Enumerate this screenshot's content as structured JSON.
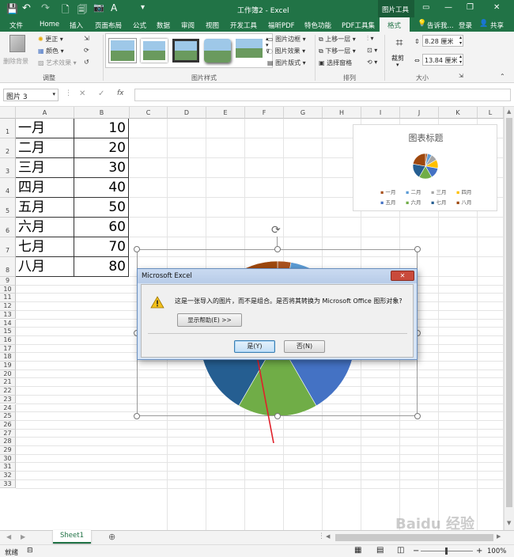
{
  "window": {
    "title": "工作簿2 - Excel",
    "context_tab_group": "图片工具",
    "controls": {
      "minimize": "—",
      "restore": "❐",
      "close": "✕"
    }
  },
  "ribbon_tabs": [
    {
      "label": "文件"
    },
    {
      "label": "Home"
    },
    {
      "label": "插入"
    },
    {
      "label": "页面布局"
    },
    {
      "label": "公式"
    },
    {
      "label": "数据"
    },
    {
      "label": "审阅"
    },
    {
      "label": "视图"
    },
    {
      "label": "开发工具"
    },
    {
      "label": "福昕PDF"
    },
    {
      "label": "特色功能"
    },
    {
      "label": "PDF工具集"
    },
    {
      "label": "格式"
    }
  ],
  "ribbon_right": {
    "tell_me": "告诉我...",
    "login": "登录",
    "share": "共享"
  },
  "ribbon": {
    "adjust": {
      "remove_bg": "删除背景",
      "corrections": "更正",
      "color": "颜色",
      "artistic": "艺术效果",
      "label": "调整"
    },
    "styles": {
      "border": "图片边框",
      "effects": "图片效果",
      "layout": "图片版式",
      "label": "图片样式"
    },
    "arrange": {
      "bring_forward": "上移一层",
      "send_backward": "下移一层",
      "selection_pane": "选择窗格",
      "label": "排列"
    },
    "size": {
      "crop": "裁剪",
      "height": "8.28 厘米",
      "width": "13.84 厘米",
      "label": "大小"
    }
  },
  "formula_bar": {
    "name_box": "图片 3",
    "fx": "fx",
    "cancel": "✕",
    "enter": "✓",
    "content": ""
  },
  "columns": [
    "A",
    "B",
    "C",
    "D",
    "E",
    "F",
    "G",
    "H",
    "I",
    "J",
    "K",
    "L"
  ],
  "rows": [
    "1",
    "2",
    "3",
    "4",
    "5",
    "6",
    "7",
    "8",
    "9",
    "10",
    "11",
    "12",
    "13",
    "14",
    "15",
    "16",
    "17",
    "18",
    "19",
    "20",
    "21",
    "22",
    "23",
    "24",
    "25",
    "26",
    "27",
    "28",
    "29",
    "30",
    "31",
    "32",
    "33"
  ],
  "cells": [
    {
      "a": "一月",
      "b": "10"
    },
    {
      "a": "二月",
      "b": "20"
    },
    {
      "a": "三月",
      "b": "30"
    },
    {
      "a": "四月",
      "b": "40"
    },
    {
      "a": "五月",
      "b": "50"
    },
    {
      "a": "六月",
      "b": "60"
    },
    {
      "a": "七月",
      "b": "70"
    },
    {
      "a": "八月",
      "b": "80"
    }
  ],
  "chart": {
    "title": "图表标题",
    "legend": [
      "一月",
      "二月",
      "三月",
      "四月",
      "五月",
      "六月",
      "七月",
      "八月"
    ],
    "colors": [
      "#a9521f",
      "#5b9bd5",
      "#a5a5a5",
      "#ffc000",
      "#4472c4",
      "#70ad47",
      "#255e91",
      "#9e480e"
    ]
  },
  "chart_data": {
    "type": "pie",
    "title": "图表标题",
    "categories": [
      "一月",
      "二月",
      "三月",
      "四月",
      "五月",
      "六月",
      "七月",
      "八月"
    ],
    "values": [
      10,
      20,
      30,
      40,
      50,
      60,
      70,
      80
    ],
    "legend": "bottom"
  },
  "dialog": {
    "title": "Microsoft Excel",
    "close": "✕",
    "message": "这是一张导入的图片，而不是组合。是否将其转换为 Microsoft Office 图形对象?",
    "help_button": "显示帮助(E) >>",
    "yes_button": "是(Y)",
    "no_button": "否(N)"
  },
  "sheet_tabs": [
    {
      "label": "Sheet1"
    }
  ],
  "add_sheet": "⊕",
  "status": {
    "ready": "就绪",
    "zoom": "100%",
    "zoom_minus": "−",
    "zoom_plus": "+"
  },
  "watermark": "Baidu 经验"
}
